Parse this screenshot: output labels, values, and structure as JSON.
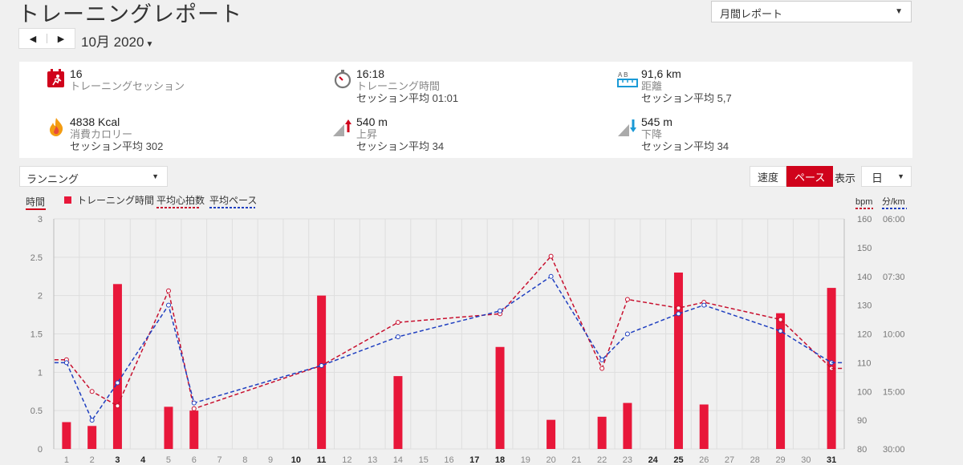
{
  "header": {
    "title": "トレーニングレポート",
    "report_select": "月間レポート",
    "month": "10月 2020"
  },
  "nav": {
    "prev": "◀",
    "next": "▶"
  },
  "summary": {
    "sessions": {
      "value": "16",
      "label": "トレーニングセッション"
    },
    "time": {
      "value": "16:18",
      "label": "トレーニング時間",
      "sub": "セッション平均 01:01"
    },
    "distance": {
      "value": "91,6 km",
      "label": "距離",
      "sub": "セッション平均 5,7"
    },
    "calories": {
      "value": "4838 Kcal",
      "label": "消費カロリー",
      "sub": "セッション平均 302"
    },
    "ascent": {
      "value": "540 m",
      "label": "上昇",
      "sub": "セッション平均 34"
    },
    "descent": {
      "value": "545 m",
      "label": "下降",
      "sub": "セッション平均 34"
    },
    "distance_icon_letters": "A B"
  },
  "controls": {
    "sport": "ランニング",
    "speed": "速度",
    "pace": "ペース",
    "show_label": "表示",
    "period": "日"
  },
  "colors": {
    "accent": "#d0021b",
    "bar": "#e8173a",
    "hr_line": "#c8102e",
    "pace_line": "#1f3fc0"
  },
  "chart_data": {
    "type": "bar",
    "left_axis_title": "時間",
    "right_axis_title_1": "bpm",
    "right_axis_title_2": "分/km",
    "legend": [
      "トレーニング時間",
      "平均心拍数",
      "平均ペース"
    ],
    "x": [
      1,
      2,
      3,
      4,
      5,
      6,
      7,
      8,
      9,
      10,
      11,
      12,
      13,
      14,
      15,
      16,
      17,
      18,
      19,
      20,
      21,
      22,
      23,
      24,
      25,
      26,
      27,
      28,
      29,
      30,
      31
    ],
    "bold_days": [
      3,
      4,
      10,
      11,
      17,
      18,
      24,
      25,
      31
    ],
    "y_left_ticks": [
      "0",
      "0.5",
      "1",
      "1.5",
      "2",
      "2.5",
      "3"
    ],
    "ylim_left": [
      0,
      3
    ],
    "y_bpm_ticks": [
      "80",
      "90",
      "100",
      "110",
      "120",
      "130",
      "140",
      "150",
      "160"
    ],
    "ylim_bpm": [
      80,
      160
    ],
    "y_pace_ticks": [
      "30:00",
      "15:00",
      "10:00",
      "07:30",
      "06:00"
    ],
    "series": [
      {
        "name": "トレーニング時間",
        "type": "bar",
        "points": [
          [
            1,
            0.35
          ],
          [
            2,
            0.3
          ],
          [
            3,
            2.15
          ],
          [
            5,
            0.55
          ],
          [
            6,
            0.5
          ],
          [
            11,
            2.0
          ],
          [
            14,
            0.95
          ],
          [
            18,
            1.33
          ],
          [
            20,
            0.38
          ],
          [
            22,
            0.42
          ],
          [
            23,
            0.6
          ],
          [
            25,
            2.3
          ],
          [
            26,
            0.58
          ],
          [
            29,
            1.77
          ],
          [
            31,
            2.1
          ]
        ]
      },
      {
        "name": "平均心拍数",
        "type": "line",
        "points": [
          [
            1,
            111
          ],
          [
            2,
            100
          ],
          [
            3,
            95
          ],
          [
            5,
            135
          ],
          [
            6,
            94
          ],
          [
            11,
            109
          ],
          [
            14,
            124
          ],
          [
            18,
            127
          ],
          [
            20,
            147
          ],
          [
            22,
            108
          ],
          [
            23,
            132
          ],
          [
            25,
            129
          ],
          [
            26,
            131
          ],
          [
            29,
            125
          ],
          [
            31,
            108
          ]
        ]
      },
      {
        "name": "平均ペース",
        "type": "line",
        "points": [
          [
            1,
            110
          ],
          [
            2,
            90
          ],
          [
            3,
            103
          ],
          [
            5,
            130
          ],
          [
            6,
            96
          ],
          [
            11,
            109
          ],
          [
            14,
            119
          ],
          [
            18,
            128
          ],
          [
            20,
            140
          ],
          [
            22,
            111
          ],
          [
            23,
            120
          ],
          [
            25,
            127
          ],
          [
            26,
            130
          ],
          [
            29,
            121
          ],
          [
            31,
            110
          ]
        ]
      }
    ]
  }
}
